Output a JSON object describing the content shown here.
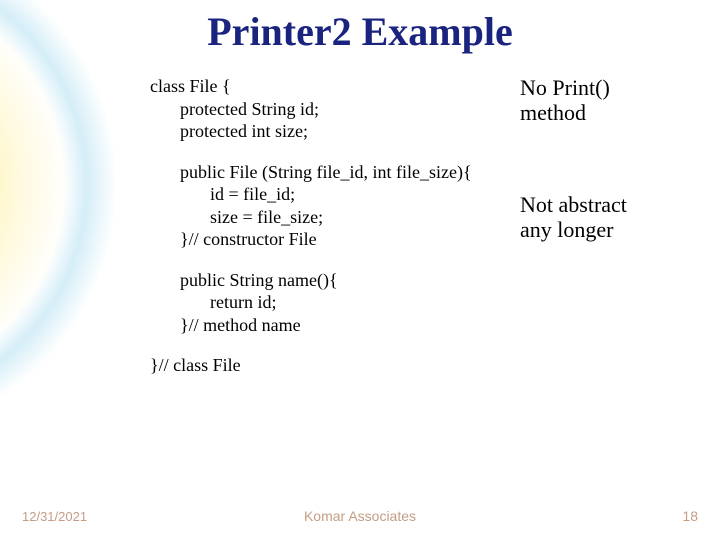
{
  "title": "Printer2 Example",
  "code": {
    "l1": "class File {",
    "l2": "protected String id;",
    "l3": "protected int size;",
    "l4": "public File (String file_id, int file_size){",
    "l5": "id = file_id;",
    "l6": "size = file_size;",
    "l7": "}// constructor File",
    "l8": "public String name(){",
    "l9": "return id;",
    "l10": "}// method name",
    "l11": "}// class File"
  },
  "notes": {
    "n1a": "No Print()",
    "n1b": "method",
    "n2a": "Not abstract",
    "n2b": "any longer"
  },
  "footer": {
    "date": "12/31/2021",
    "org": "Komar Associates",
    "page": "18"
  }
}
